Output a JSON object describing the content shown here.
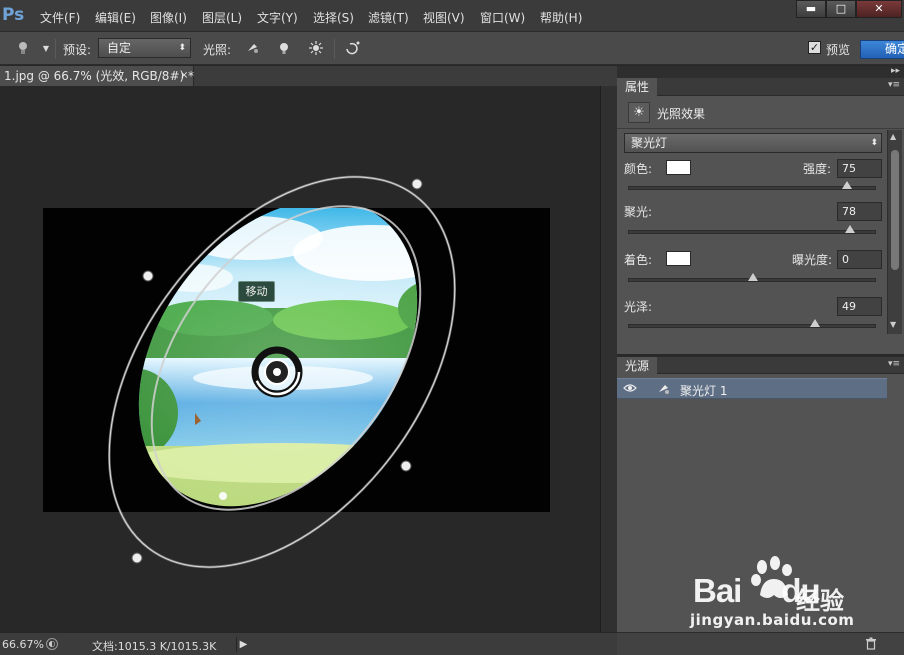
{
  "app": {
    "logo": "Ps"
  },
  "menu": [
    "文件(F)",
    "编辑(E)",
    "图像(I)",
    "图层(L)",
    "文字(Y)",
    "选择(S)",
    "滤镜(T)",
    "视图(V)",
    "窗口(W)",
    "帮助(H)"
  ],
  "window_buttons": {
    "minimize": "▬",
    "maximize": "□",
    "close": "✕"
  },
  "options": {
    "preset_label": "预设:",
    "preset_value": "自定",
    "lights_label": "光照:",
    "preview_label": "预览",
    "preview_checked": "✓",
    "ok_label": "确定"
  },
  "document": {
    "tab_title": "1.jpg @ 66.7% (光效, RGB/8#) *",
    "tab_close": "×",
    "move_tooltip": "移动"
  },
  "status": {
    "zoom": "66.67%",
    "doc_info": "文档:1015.3 K/1015.3K",
    "arrow": "▶"
  },
  "properties": {
    "tab": "属性",
    "title": "光照效果",
    "light_type": "聚光灯",
    "color_label": "颜色:",
    "color_value": "#ffffff",
    "intensity_label": "强度:",
    "intensity_value": "75",
    "intensity_pct": 0.88,
    "hotspot_label": "聚光:",
    "hotspot_value": "78",
    "hotspot_pct": 0.89,
    "colorize_label": "着色:",
    "colorize_value": "#ffffff",
    "exposure_label": "曝光度:",
    "exposure_value": "0",
    "exposure_pct": 0.5,
    "gloss_label": "光泽:",
    "gloss_value": "49",
    "gloss_pct": 0.75
  },
  "lights_panel": {
    "tab": "光源",
    "items": [
      {
        "name": "聚光灯 1"
      }
    ]
  },
  "watermark": {
    "brand": "Bai",
    "brand2": "du",
    "cn": "经验",
    "url": "jingyan.baidu.com"
  }
}
